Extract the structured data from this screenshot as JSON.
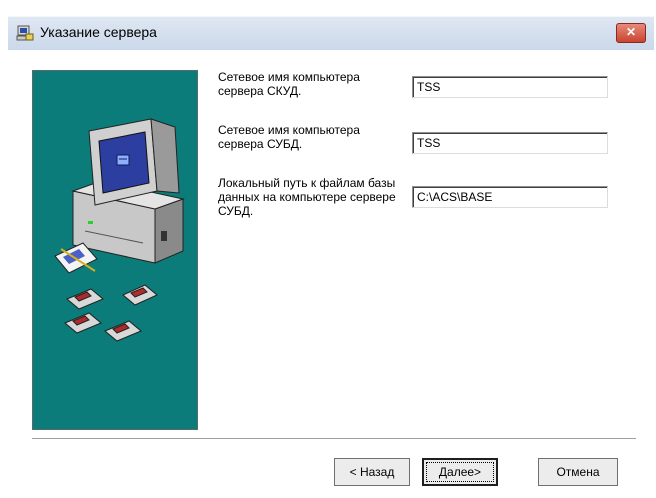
{
  "window": {
    "title": "Указание сервера",
    "close_symbol": "✕"
  },
  "form": {
    "fields": [
      {
        "label": "Сетевое имя компьютера сервера СКУД.",
        "value": "TSS"
      },
      {
        "label": "Сетевое имя компьютера сервера СУБД.",
        "value": "TSS"
      },
      {
        "label": "Локальный путь к файлам базы данных на компьютере сервере СУБД.",
        "value": "C:\\ACS\\BASE"
      }
    ]
  },
  "buttons": {
    "back_label": "< Назад",
    "next_label": "Далее>",
    "cancel_label": "Отмена"
  },
  "icons": {
    "app": "computer-setup-icon",
    "illustration": "computer-with-floppy-disks"
  },
  "colors": {
    "art_background": "#0b7c79",
    "titlebar": "#cad8ea",
    "close": "#c94430"
  }
}
